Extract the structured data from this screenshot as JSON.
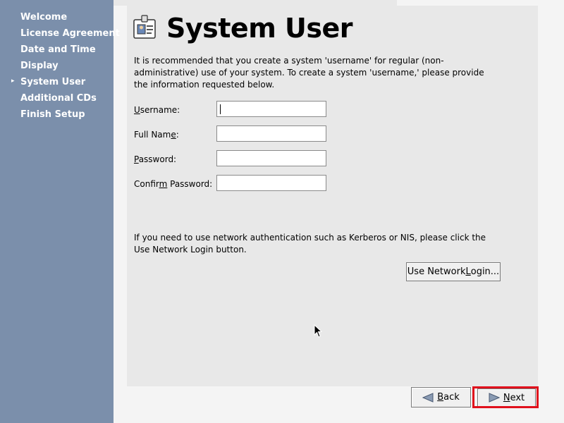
{
  "sidebar": {
    "steps": [
      {
        "label": "Welcome"
      },
      {
        "label": "License Agreement"
      },
      {
        "label": "Date and Time"
      },
      {
        "label": "Display"
      },
      {
        "label": "System User",
        "current": true
      },
      {
        "label": "Additional CDs"
      },
      {
        "label": "Finish Setup"
      }
    ],
    "current_marker": "▸"
  },
  "header": {
    "title": "System User",
    "icon": "id-badge-icon"
  },
  "intro_text": "It is recommended that you create a system 'username' for regular (non-administrative) use of your system. To create a system 'username,' please provide the information requested below.",
  "form": {
    "username": {
      "label_pre": "",
      "label_u": "U",
      "label_post": "sername:",
      "value": ""
    },
    "fullname": {
      "label_pre": "Full Nam",
      "label_u": "e",
      "label_post": ":",
      "value": ""
    },
    "password": {
      "label_pre": "",
      "label_u": "P",
      "label_post": "assword:",
      "value": ""
    },
    "confirm": {
      "label_pre": "Confir",
      "label_u": "m",
      "label_post": " Password:",
      "value": ""
    }
  },
  "network_text": "If you need to use network authentication such as Kerberos or NIS, please click the Use Network Login button.",
  "network_button": {
    "pre": "Use Network ",
    "u": "L",
    "post": "ogin..."
  },
  "nav": {
    "back": {
      "u": "B",
      "post": "ack"
    },
    "next": {
      "u": "N",
      "post": "ext"
    }
  },
  "colors": {
    "sidebar": "#7b8fab",
    "highlight": "#e0101c",
    "arrow": "#8a9bb3"
  }
}
